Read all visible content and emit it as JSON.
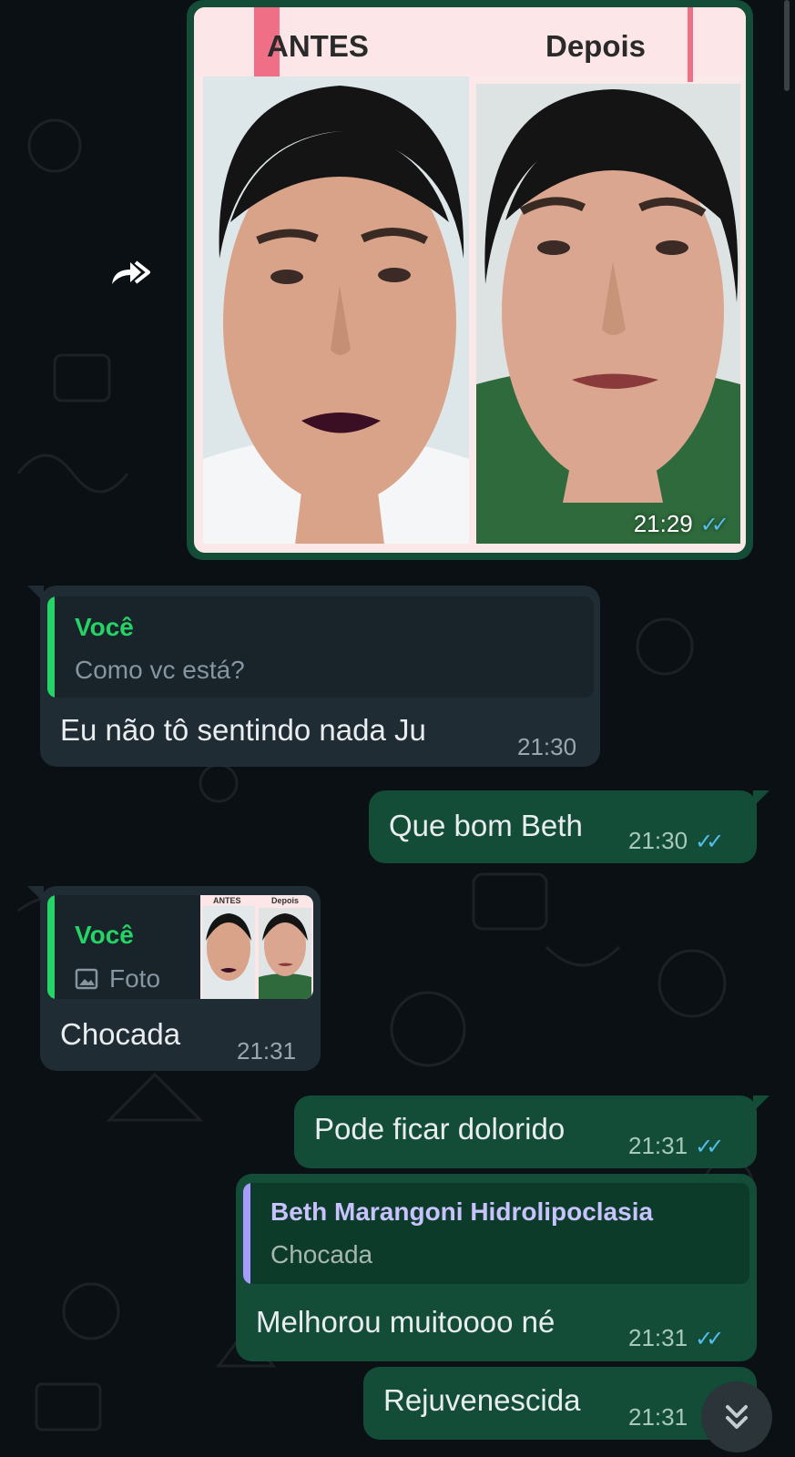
{
  "image_message": {
    "label_before": "ANTES",
    "label_after": "Depois",
    "time": "21:29",
    "status_icon": "double-check-read-icon"
  },
  "messages": [
    {
      "direction": "in",
      "quote_author": "Você",
      "quote_text": "Como vc está?",
      "text": "Eu não tô sentindo nada Ju",
      "time": "21:30"
    },
    {
      "direction": "out",
      "text": "Que bom Beth",
      "time": "21:30"
    },
    {
      "direction": "in",
      "quote_author": "Você",
      "quote_text": "Foto",
      "quote_thumb_before": "ANTES",
      "quote_thumb_after": "Depois",
      "text": "Chocada",
      "time": "21:31"
    },
    {
      "direction": "out",
      "text": "Pode ficar dolorido",
      "time": "21:31"
    },
    {
      "direction": "out",
      "quote_author": "Beth Marangoni Hidrolipoclasia",
      "quote_text": "Chocada",
      "text": "Melhorou muitoooo né",
      "time": "21:31"
    },
    {
      "direction": "out",
      "text": "Rejuvenescida",
      "time": "21:31"
    }
  ],
  "colors": {
    "background": "#0b1014",
    "incoming_bubble": "#1f2c34",
    "outgoing_bubble": "#134d37",
    "quote_you": "#25d366",
    "quote_other": "#a79bff",
    "read_ticks": "#53bdeb"
  },
  "icons": {
    "forward": "forward-icon",
    "photo": "photo-icon",
    "scroll_down": "double-chevron-down-icon"
  }
}
